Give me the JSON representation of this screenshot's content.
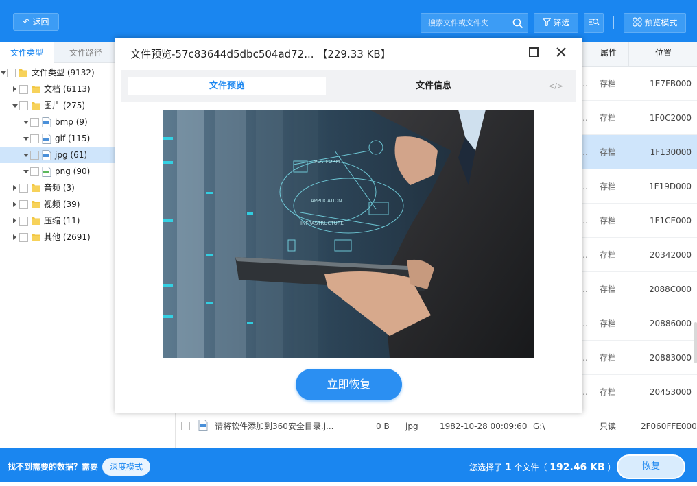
{
  "toolbar": {
    "back_label": "返回",
    "search_placeholder": "搜索文件或文件夹",
    "filter_label": "筛选",
    "preview_mode_label": "预览模式"
  },
  "sidebar": {
    "tab_type": "文件类型",
    "tab_path": "文件路径",
    "tree": [
      {
        "label": "文件类型 (9132)"
      },
      {
        "label": "文档 (6113)"
      },
      {
        "label": "图片 (275)"
      },
      {
        "label": "bmp (9)"
      },
      {
        "label": "gif (115)"
      },
      {
        "label": "jpg (61)"
      },
      {
        "label": "png (90)"
      },
      {
        "label": "音频 (3)"
      },
      {
        "label": "视频 (39)"
      },
      {
        "label": "压缩 (11)"
      },
      {
        "label": "其他 (2691)"
      }
    ]
  },
  "table": {
    "col_attr": "属性",
    "col_pos": "位置",
    "rows": [
      {
        "dots": "..",
        "attr": "存档",
        "pos": "1E7FB000"
      },
      {
        "dots": "..",
        "attr": "存档",
        "pos": "1F0C2000"
      },
      {
        "dots": "..",
        "attr": "存档",
        "pos": "1F130000"
      },
      {
        "dots": "..",
        "attr": "存档",
        "pos": "1F19D000"
      },
      {
        "dots": "..",
        "attr": "存档",
        "pos": "1F1CE000"
      },
      {
        "dots": "..",
        "attr": "存档",
        "pos": "20342000"
      },
      {
        "dots": "..",
        "attr": "存档",
        "pos": "2088C000"
      },
      {
        "dots": "..",
        "attr": "存档",
        "pos": "20886000"
      },
      {
        "dots": "..",
        "attr": "存档",
        "pos": "20883000"
      },
      {
        "dots": "..",
        "attr": "存档",
        "pos": "20453000"
      }
    ],
    "last_row": {
      "name": "请将软件添加到360安全目录.j...",
      "size": "0 B",
      "type": "jpg",
      "date": "1982-10-28 00:09:60",
      "path": "G:\\",
      "attr": "只读",
      "pos": "2F060FFE000"
    }
  },
  "modal": {
    "title": "文件预览-57c83644d5dbc504ad72... 【229.33 KB】",
    "tab_preview": "文件预览",
    "tab_info": "文件信息",
    "code_icon_text": "</>",
    "recover_label": "立即恢复"
  },
  "bottom": {
    "ask": "找不到需要的数据？需要",
    "deep_mode": "深度模式",
    "selected_prefix": "您选择了",
    "selected_count": "1",
    "selected_mid": "个文件（",
    "selected_size": "192.46 KB",
    "selected_suffix": "）",
    "recover_label": "恢复"
  },
  "colors": {
    "primary": "#1a86f0",
    "selected_row": "#cfe5fb"
  }
}
